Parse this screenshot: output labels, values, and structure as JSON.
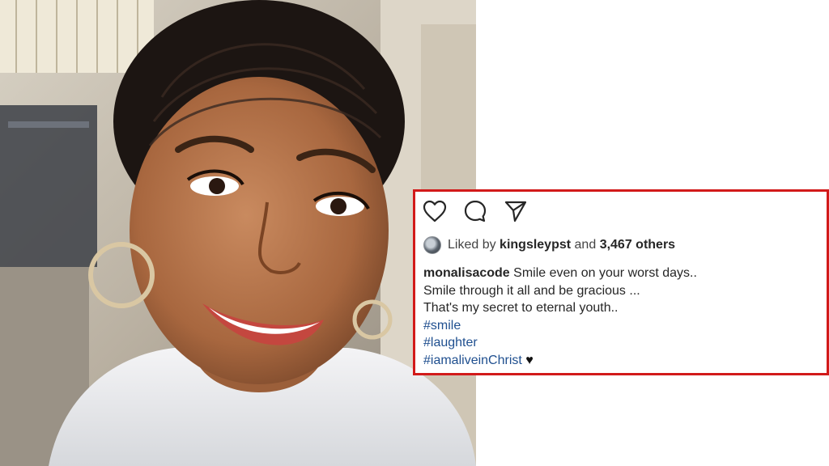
{
  "post": {
    "actions": [
      {
        "name": "like-icon"
      },
      {
        "name": "comment-icon"
      },
      {
        "name": "share-icon"
      }
    ],
    "likes": {
      "prefix": "Liked by",
      "user": "kingsleypst",
      "connector": "and",
      "others": "3,467 others"
    },
    "caption": {
      "username": "monalisacode",
      "lines": [
        "Smile even on your worst days..",
        "Smile through it all and be gracious ...",
        "That's my secret to eternal youth.."
      ],
      "hashtags": [
        "#smile",
        "#laughter",
        "#iamaliveinChrist"
      ],
      "emoji": "♥"
    }
  },
  "colors": {
    "highlight_border": "#d21a1a",
    "hashtag": "#1f4f8f"
  }
}
